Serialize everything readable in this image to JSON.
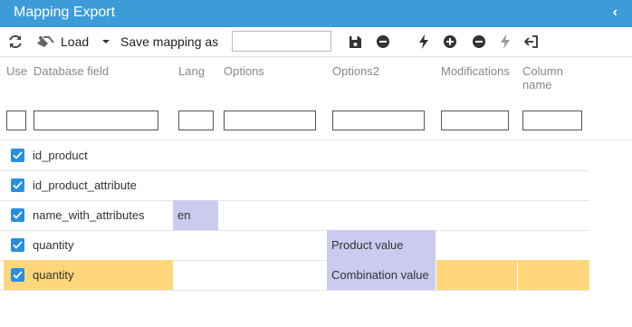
{
  "window": {
    "title": "Mapping Export"
  },
  "toolbar": {
    "load_label": "Load",
    "save_mapping_label": "Save mapping as",
    "save_name_value": ""
  },
  "columns": {
    "use": "Use",
    "database_field": "Database field",
    "lang": "Lang",
    "options": "Options",
    "options2": "Options2",
    "modifications": "Modifications",
    "column_name_line1": "Column",
    "column_name_line2": "name"
  },
  "rows": [
    {
      "checked": true,
      "field": "id_product",
      "lang": "",
      "options": "",
      "options2": "",
      "modifications": "",
      "column_name": ""
    },
    {
      "checked": true,
      "field": "id_product_attribute",
      "lang": "",
      "options": "",
      "options2": "",
      "modifications": "",
      "column_name": ""
    },
    {
      "checked": true,
      "field": "name_with_attributes",
      "lang": "en",
      "options": "",
      "options2": "",
      "modifications": "",
      "column_name": ""
    },
    {
      "checked": true,
      "field": "quantity",
      "lang": "",
      "options": "",
      "options2": "Product value",
      "modifications": "",
      "column_name": ""
    },
    {
      "checked": true,
      "field": "quantity",
      "lang": "",
      "options": "",
      "options2": "Combination value",
      "modifications": "",
      "column_name": ""
    }
  ],
  "colors": {
    "header_blue": "#3d9bd8",
    "checkbox_blue": "#2a8ee0",
    "highlight_purple": "#cbcbf0",
    "selected_yellow": "#ffd77a"
  }
}
